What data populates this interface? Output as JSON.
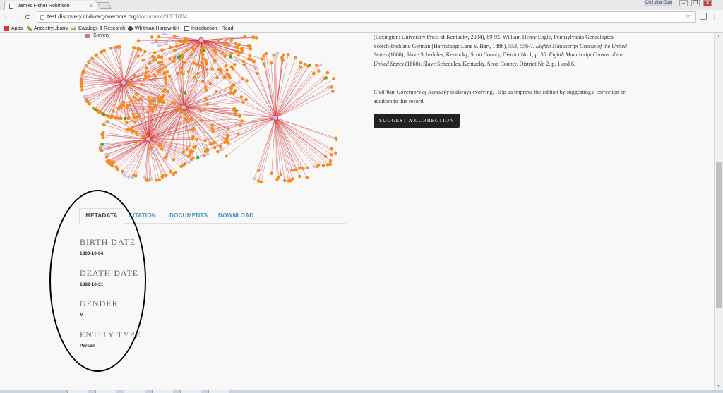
{
  "browser": {
    "tab_title": "James Fisher Robinson",
    "tab_close": "×",
    "window_title": "Civil War Gove...",
    "url_host": "test.discovery.civilwargovernors.org",
    "url_path": "/document/N001004",
    "nav": {
      "back": "←",
      "forward": "→",
      "reload": "C"
    },
    "win_buttons": {
      "minimize": "–",
      "maximize": "❐",
      "close": "✕"
    },
    "bookmarks": [
      {
        "label": "Apps",
        "icon": "apps-grid-icon"
      },
      {
        "label": "AncestryLibrary",
        "icon": "leaf-icon"
      },
      {
        "label": "Catalogs & Research",
        "icon": "arrow-icon"
      },
      {
        "label": "Whitman Handwritin",
        "icon": "portrait-icon"
      },
      {
        "label": "Introduction - Readi",
        "icon": "page-icon"
      }
    ]
  },
  "graph": {
    "legend_label": "Slavery",
    "colors": {
      "edge": "#d63a3a",
      "node_primary": "#f58a1f",
      "node_secondary": "#c9c4e6",
      "node_tertiary": "#3aa83a",
      "hub": "#e0405a"
    }
  },
  "citation": {
    "line1": "(Lexington: University Press of Kentucky, 2004), 89-92. William Henry Engle, Pennsylvania Genealogies:",
    "line2_a": "Scotch-Irish and German (Harrisburg: Lane S. Hart, 1886), 553, 556-7. ",
    "line2_em": "Eighth Manuscript Census of the United",
    "line3_em1": "States",
    "line3_a": " (1860), Slave Schedules, Kentucky, Scott County, District No 1, p. 35. ",
    "line3_em2": "Eighth Manuscript Census of the",
    "line4_em": "United States",
    "line4_a": " (1860), Slave Schedules, Kentucky, Scott County, District No 2, p. 1 and 6."
  },
  "notice": {
    "title_em": "Civil War Governors of Kentucky",
    "text_a": " is always evolving. Help us improve the edition by suggesting a correction or",
    "text_b": "addition to this record."
  },
  "suggest_button": "SUGGEST A CORRECTION",
  "tabs": [
    "METADATA",
    "CITATION",
    "DOCUMENTS",
    "DOWNLOAD"
  ],
  "metadata": {
    "birth_label": "BIRTH DATE",
    "birth_value": "1800-10-04",
    "death_label": "DEATH DATE",
    "death_value": "1882-10-31",
    "gender_label": "GENDER",
    "gender_value": "M",
    "entity_label": "ENTITY TYPE",
    "entity_value": "Person"
  }
}
